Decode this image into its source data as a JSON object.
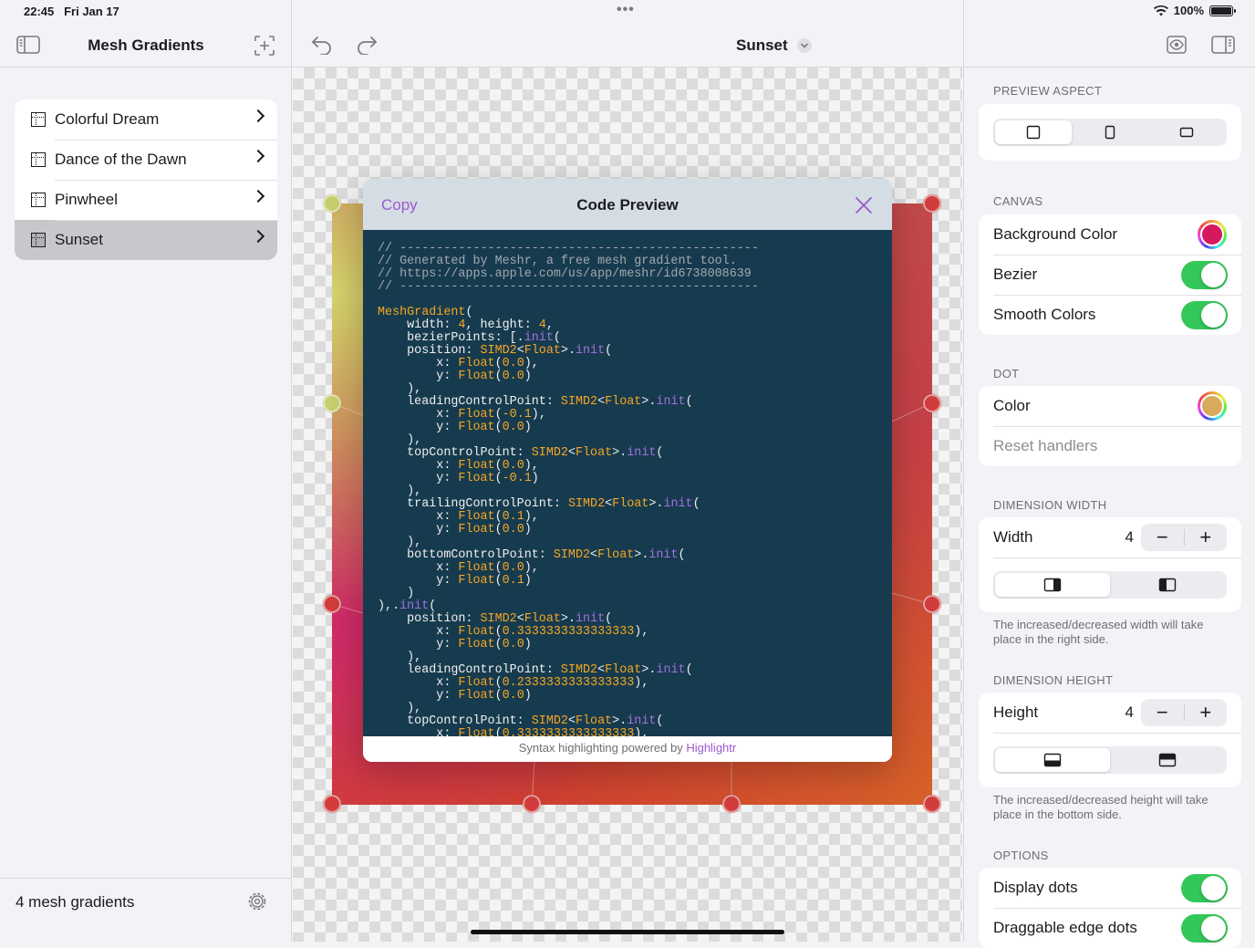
{
  "status": {
    "time": "22:45",
    "date": "Fri Jan 17",
    "battery": "100%"
  },
  "sidebar": {
    "title": "Mesh Gradients",
    "items": [
      {
        "label": "Colorful Dream"
      },
      {
        "label": "Dance of the Dawn"
      },
      {
        "label": "Pinwheel"
      },
      {
        "label": "Sunset",
        "selected": true
      }
    ],
    "footer_count": "4 mesh gradients"
  },
  "toolbar": {
    "document_title": "Sunset"
  },
  "modal": {
    "copy_label": "Copy",
    "title": "Code Preview",
    "footer_text": "Syntax highlighting powered by ",
    "footer_link": "Highlightr"
  },
  "inspector": {
    "preview_aspect_title": "PREVIEW ASPECT",
    "canvas_title": "CANVAS",
    "background_color_label": "Background Color",
    "background_color": "#d6185f",
    "bezier_label": "Bezier",
    "bezier_on": true,
    "smooth_colors_label": "Smooth Colors",
    "smooth_colors_on": true,
    "dot_title": "DOT",
    "dot_color_label": "Color",
    "dot_color": "#d9a95c",
    "reset_handlers_label": "Reset handlers",
    "dimension_width_title": "DIMENSION WIDTH",
    "width_label": "Width",
    "width_value": "4",
    "width_note": "The increased/decreased width will take place in the right side.",
    "dimension_height_title": "DIMENSION HEIGHT",
    "height_label": "Height",
    "height_value": "4",
    "height_note": "The increased/decreased height will take place in the bottom side.",
    "options_title": "OPTIONS",
    "display_dots_label": "Display dots",
    "display_dots_on": true,
    "draggable_edge_dots_label": "Draggable edge dots",
    "draggable_edge_dots_on": true
  }
}
